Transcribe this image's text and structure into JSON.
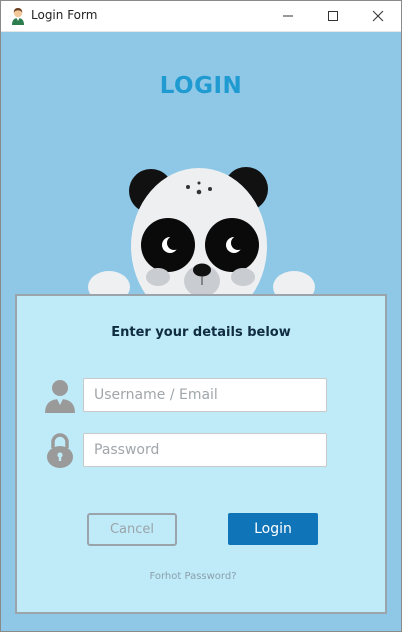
{
  "window": {
    "title": "Login Form",
    "icon": "user-avatar-icon"
  },
  "titlebar_buttons": {
    "minimize": "minimize-icon",
    "maximize": "maximize-icon",
    "close": "close-icon"
  },
  "heading": "LOGIN",
  "mascot": "panda-mascot",
  "form": {
    "instruction": "Enter your details below",
    "username": {
      "placeholder": "Username / Email",
      "value": "",
      "icon": "user-icon"
    },
    "password": {
      "placeholder": "Password",
      "value": "",
      "icon": "lock-icon"
    },
    "cancel_label": "Cancel",
    "login_label": "Login",
    "forgot_label": "Forhot Password?"
  },
  "colors": {
    "window_bg": "#8ec8e6",
    "card_bg": "#bfeaf8",
    "heading": "#1f9bd1",
    "login_button": "#0f75b8",
    "muted_gray": "#9aa4aa"
  }
}
